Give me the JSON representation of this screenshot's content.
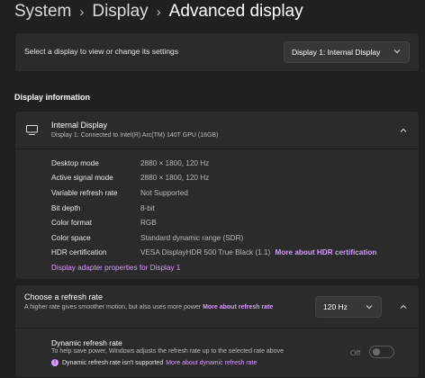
{
  "breadcrumb": {
    "items": [
      "System",
      "Display",
      "Advanced display"
    ]
  },
  "selector": {
    "label": "Select a display to view or change its settings",
    "value": "Display 1: Internal Display"
  },
  "section_title": "Display information",
  "display_info": {
    "title": "Internal Display",
    "subtitle": "Display 1: Connected to Intel(R) Arc(TM) 140T GPU (16GB)",
    "rows": [
      {
        "key": "Desktop mode",
        "value": "2880 × 1800, 120 Hz"
      },
      {
        "key": "Active signal mode",
        "value": "2880 × 1800, 120 Hz"
      },
      {
        "key": "Variable refresh rate",
        "value": "Not Supported"
      },
      {
        "key": "Bit depth",
        "value": "8-bit"
      },
      {
        "key": "Color format",
        "value": "RGB"
      },
      {
        "key": "Color space",
        "value": "Standard dynamic range (SDR)"
      },
      {
        "key": "HDR certification",
        "value": "VESA DisplayHDR 500 True Black (1.1)",
        "link": "More about HDR certification"
      }
    ],
    "adapter_link": "Display adapter properties for Display 1"
  },
  "refresh": {
    "title": "Choose a refresh rate",
    "description": "A higher rate gives smoother motion, but also uses more power",
    "description_link": "More about refresh rate",
    "selected_rate": "120 Hz"
  },
  "dynamic_refresh": {
    "title": "Dynamic refresh rate",
    "description": "To help save power, Windows adjusts the refresh rate up to the selected rate above",
    "warning": "Dynamic refresh rate isn't supported",
    "warning_link": "More about dynamic refresh rate",
    "toggle_label": "Off",
    "toggle_on": false
  },
  "colors": {
    "background": "#202020",
    "card": "#2b2b2b",
    "accent_link": "#d89bff"
  }
}
